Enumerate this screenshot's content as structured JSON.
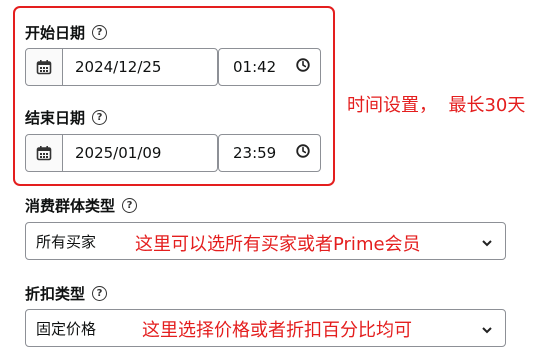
{
  "start_date": {
    "label": "开始日期",
    "date_value": "2024/12/25",
    "time_value": "01:42"
  },
  "end_date": {
    "label": "结束日期",
    "date_value": "2025/01/09",
    "time_value": "23:59"
  },
  "consumer_group": {
    "label": "消费群体类型",
    "selected": "所有买家",
    "note": "这里可以选所有买家或者Prime会员"
  },
  "discount_type": {
    "label": "折扣类型",
    "selected": "固定价格",
    "note": "这里选择价格或者折扣百分比均可"
  },
  "time_note": "时间设置，  最长30天",
  "help_glyph": "?",
  "colors": {
    "annotation_red": "#e41e1e",
    "border_gray": "#8d9096",
    "text": "#0f1111"
  },
  "icons": {
    "calendar": "calendar-icon",
    "clock": "clock-icon",
    "help": "help-circle-icon",
    "dropdown": "chevron-down-icon"
  }
}
